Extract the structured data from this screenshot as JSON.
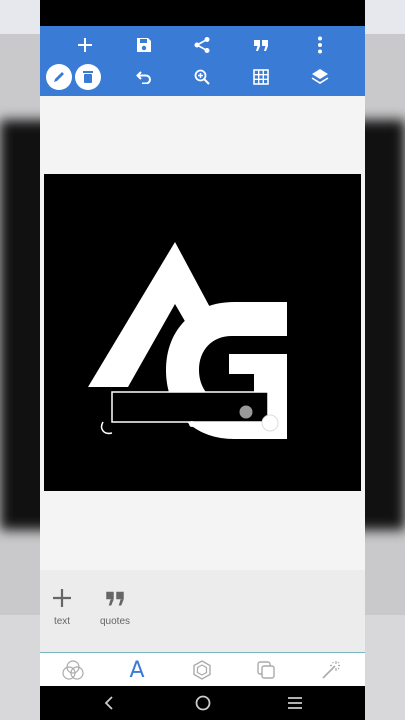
{
  "toolbar": {
    "row1": [
      "add-icon",
      "save-icon",
      "share-icon",
      "quote-icon",
      "more-vert-icon"
    ],
    "row2": [
      "edit-icon",
      "delete-icon",
      "undo-icon",
      "zoom-in-icon",
      "grid-icon",
      "layers-icon"
    ]
  },
  "colors": {
    "toolbar": "#3a7bd5",
    "accent": "#3a7bd5",
    "artboard": "#000000",
    "logo": "#ffffff"
  },
  "tools": {
    "text_label": "text",
    "quotes_label": "quotes"
  },
  "tabs": [
    "blend-icon",
    "text-tab-icon",
    "shape-icon",
    "layers-copy-icon",
    "magic-wand-icon"
  ],
  "tab_text_glyph": "A",
  "nav": [
    "back-icon",
    "home-icon",
    "recents-icon"
  ]
}
